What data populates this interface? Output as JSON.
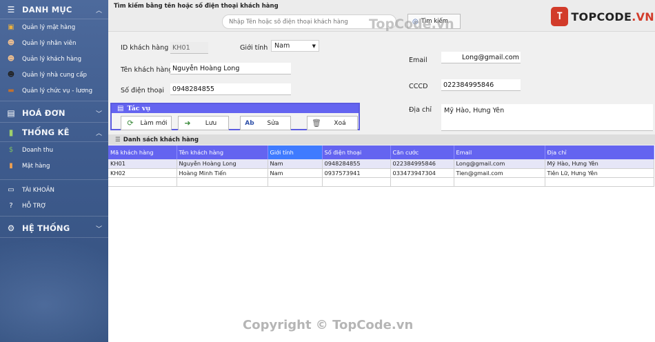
{
  "sidebar": {
    "groups": [
      {
        "label": "DANH MỤC",
        "icon": "list-icon"
      },
      {
        "label": "HOÁ ĐƠN",
        "icon": "invoice-icon"
      },
      {
        "label": "THỐNG KÊ",
        "icon": "bar-chart-icon"
      },
      {
        "label": "HỆ THỐNG",
        "icon": "gear-icon"
      }
    ],
    "danh_muc_items": [
      {
        "label": "Quản lý mặt hàng",
        "icon": "box-icon"
      },
      {
        "label": "Quản lý nhân viên",
        "icon": "employee-icon"
      },
      {
        "label": "Quản lý khách hàng",
        "icon": "customer-icon"
      },
      {
        "label": "Quản lý nhà cung cấp",
        "icon": "supplier-icon"
      },
      {
        "label": "Quản lý chức vụ - lương",
        "icon": "briefcase-icon"
      }
    ],
    "thong_ke_items": [
      {
        "label": "Doanh thu",
        "icon": "money-icon"
      },
      {
        "label": "Mặt hàng",
        "icon": "chart-icon"
      }
    ],
    "misc_items": [
      {
        "label": "TÀI KHOẢN",
        "icon": "id-card-icon"
      },
      {
        "label": "HỖ TRỢ",
        "icon": "help-icon"
      }
    ]
  },
  "search": {
    "title": "Tìm kiếm bằng tên hoặc số điện thoại khách hàng",
    "placeholder": "Nhập Tên hoặc số điện thoại khách hàng",
    "button_label": "Tìm kiếm"
  },
  "form": {
    "id_label": "ID khách hàng",
    "id_value": "KH01",
    "gender_label": "Giới tính",
    "gender_value": "Nam",
    "name_label": "Tên khách hàng",
    "name_value": "Nguyễn Hoàng Long",
    "phone_label": "Số điện thoại",
    "phone_value": "0948284855",
    "email_label": "Email",
    "email_value": "Long@gmail.com",
    "cccd_label": "CCCD",
    "cccd_value": "022384995846",
    "address_label": "Địa chỉ",
    "address_value": "Mỹ Hào, Hưng Yên"
  },
  "actions": {
    "title": "Tác vụ",
    "new_label": "Làm mới",
    "save_label": "Lưu",
    "edit_label": "Sửa",
    "delete_label": "Xoá"
  },
  "list": {
    "title": "Danh sách khách hàng",
    "columns": [
      "Mã khách hàng",
      "Tên khách hàng",
      "Giới tính",
      "Số điện thoại",
      "Căn cước",
      "Email",
      "Địa chỉ"
    ],
    "rows": [
      [
        "KH01",
        "Nguyễn Hoàng Long",
        "Nam",
        "0948284855",
        "022384995846",
        "Long@gmail.com",
        "Mỹ Hào, Hưng Yên"
      ],
      [
        "KH02",
        "Hoàng Minh Tiến",
        "Nam",
        "0937573941",
        "033473947304",
        "Tien@gmail.com",
        "Tiên Lữ, Hưng Yên"
      ]
    ]
  },
  "brand": {
    "mark": "T",
    "name": "TOPCODE",
    "tld": ".VN"
  },
  "watermark": {
    "top": "TopCode.vn",
    "bottom": "Copyright © TopCode.vn"
  },
  "colors": {
    "sidebar": "#3e5b8d",
    "accent": "#6464f0",
    "highlight": "#3f7bff",
    "brand_red": "#d23b2a"
  }
}
